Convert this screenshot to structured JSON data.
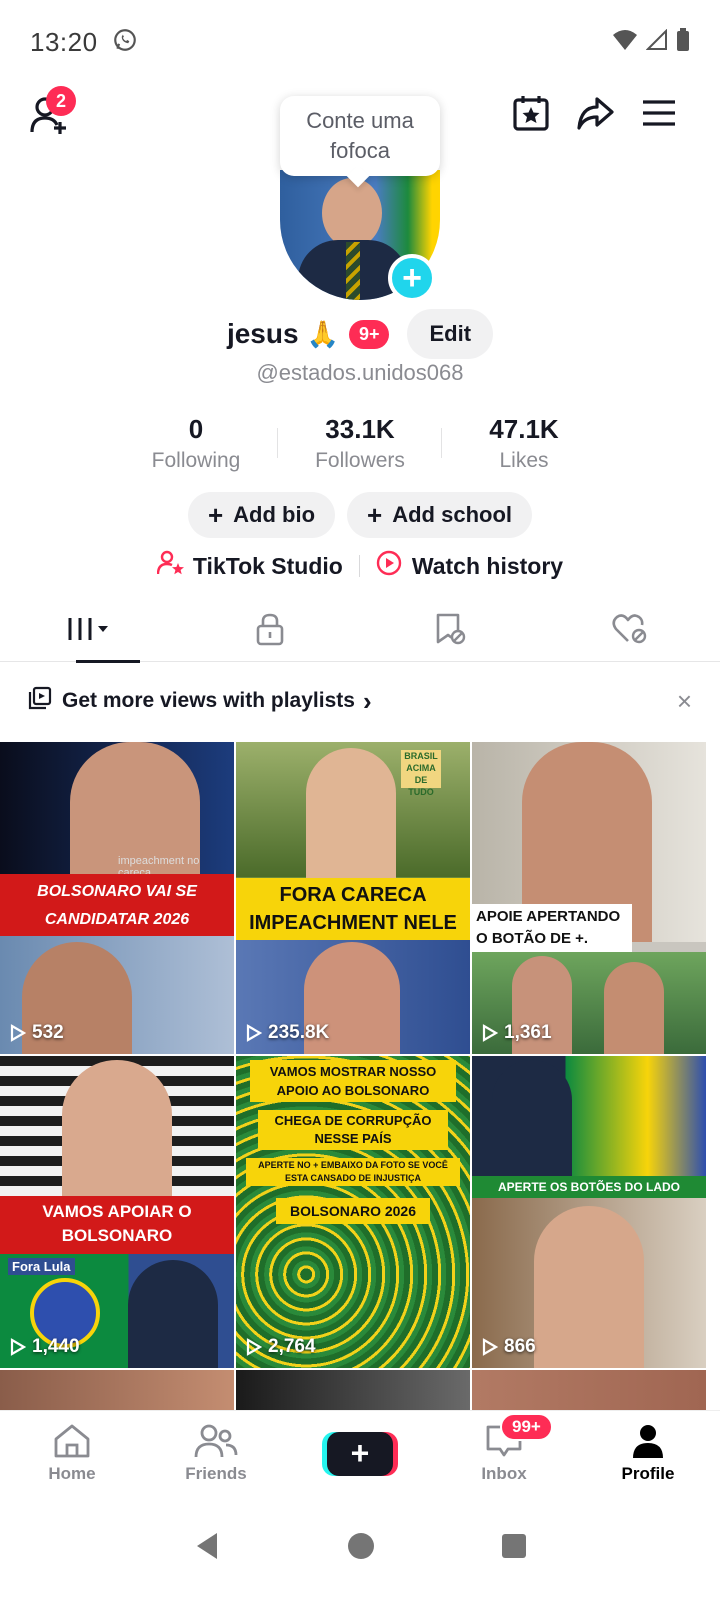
{
  "status_bar": {
    "time": "13:20"
  },
  "header": {
    "friend_badge": "2"
  },
  "tooltip": {
    "text": "Conte uma fofoca"
  },
  "profile": {
    "display_name": "jesus",
    "emoji": "🙏",
    "badge": "9+",
    "edit_label": "Edit",
    "username": "@estados.unidos068"
  },
  "stats": [
    {
      "value": "0",
      "label": "Following"
    },
    {
      "value": "33.1K",
      "label": "Followers"
    },
    {
      "value": "47.1K",
      "label": "Likes"
    }
  ],
  "actions": {
    "add_bio": "Add bio",
    "add_school": "Add school"
  },
  "links": {
    "studio": "TikTok Studio",
    "watch_history": "Watch history"
  },
  "playlist_banner": {
    "text": "Get more views with playlists",
    "chevron": "›",
    "close": "×"
  },
  "videos": [
    {
      "views": "532",
      "caption": "BOLSONARO VAI SE CANDIDATAR 2026",
      "small_text": "impeachment no careca"
    },
    {
      "views": "235.8K",
      "caption": "FORA CARECA IMPEACHMENT NELE",
      "sign_text": "BRASIL ACIMA DE TUDO"
    },
    {
      "views": "1,361",
      "caption": "APOIE APERTANDO O BOTÃO DE +."
    },
    {
      "views": "1,440",
      "caption": "VAMOS APOIAR O BOLSONARO",
      "tag": "Fora Lula"
    },
    {
      "views": "2,764",
      "caption_1": "VAMOS MOSTRAR NOSSO APOIO AO BOLSONARO",
      "caption_2": "CHEGA DE CORRUPÇÃO NESSE PAÍS",
      "caption_3": "APERTE NO + EMBAIXO DA FOTO SE VOCÊ ESTA CANSADO DE INJUSTIÇA",
      "caption_4": "BOLSONARO 2026"
    },
    {
      "views": "866",
      "caption": "APERTE OS BOTÕES DO LADO"
    }
  ],
  "bottom_nav": {
    "home": "Home",
    "friends": "Friends",
    "inbox": "Inbox",
    "inbox_badge": "99+",
    "profile": "Profile",
    "create": "+"
  },
  "colors": {
    "accent": "#fe2c55",
    "cyan": "#25f4ee",
    "text": "#161823",
    "muted": "#8a8b91"
  }
}
